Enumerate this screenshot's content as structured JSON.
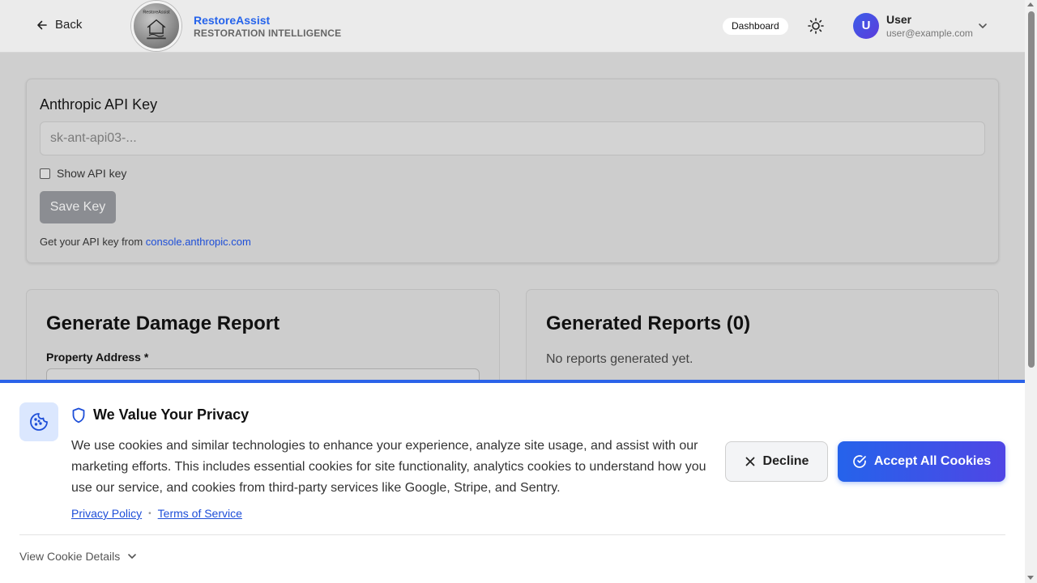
{
  "header": {
    "back_label": "Back",
    "brand_name": "RestoreAssist",
    "brand_subtitle": "RESTORATION INTELLIGENCE",
    "logo_text": "RestoreAssist",
    "dashboard_label": "Dashboard",
    "user": {
      "avatar_initial": "U",
      "name": "User",
      "email": "user@example.com"
    }
  },
  "api_card": {
    "title": "Anthropic API Key",
    "input_placeholder": "sk-ant-api03-...",
    "input_value": "",
    "show_label": "Show API key",
    "show_checked": false,
    "save_label": "Save Key",
    "get_key_prefix": "Get your API key from",
    "get_key_link": "console.anthropic.com"
  },
  "generate_card": {
    "title": "Generate Damage Report",
    "address_label": "Property Address *"
  },
  "reports_card": {
    "title": "Generated Reports (0)",
    "empty_text": "No reports generated yet."
  },
  "cookie_banner": {
    "title": "We Value Your Privacy",
    "body": "We use cookies and similar technologies to enhance your experience, analyze site usage, and assist with our marketing efforts. This includes essential cookies for site functionality, analytics cookies to understand how you use our service, and cookies from third-party services like Google, Stripe, and Sentry.",
    "privacy_link": "Privacy Policy",
    "separator": "•",
    "terms_link": "Terms of Service",
    "decline_label": "Decline",
    "accept_label": "Accept All Cookies",
    "details_label": "View Cookie Details"
  },
  "icons": {
    "back": "arrow-left-icon",
    "theme": "sun-icon",
    "user_menu": "chevron-down-icon",
    "cookie": "cookie-icon",
    "privacy": "shield-icon",
    "decline": "close-icon",
    "accept": "check-circle-icon",
    "details": "chevron-down-icon"
  },
  "colors": {
    "accent": "#2563eb",
    "accent_gradient_end": "#4f46e5",
    "overlay": "#cfcfcf"
  }
}
